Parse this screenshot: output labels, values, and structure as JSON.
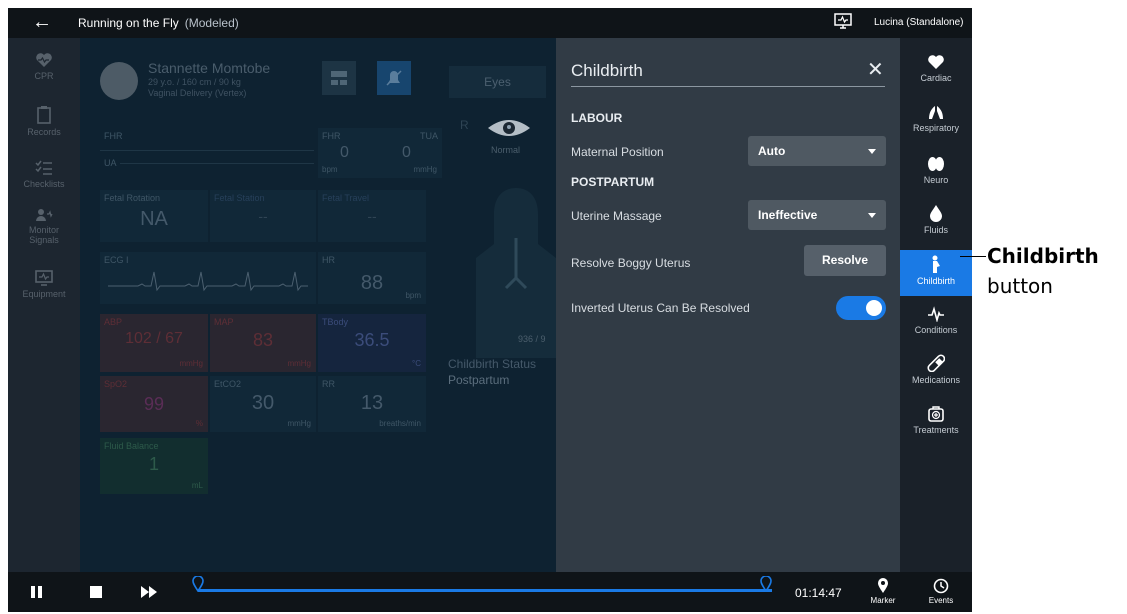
{
  "topbar": {
    "title": "Running on the Fly",
    "mode": "(Modeled)",
    "user": "Lucina (Standalone)"
  },
  "leftnav": [
    {
      "label": "CPR",
      "icon": "heart-pulse-icon"
    },
    {
      "label": "Records",
      "icon": "clipboard-icon"
    },
    {
      "label": "Checklists",
      "icon": "checklist-icon"
    },
    {
      "label": "Monitor Signals",
      "icon": "person-signal-icon"
    },
    {
      "label": "Equipment",
      "icon": "monitor-icon"
    }
  ],
  "patient": {
    "name": "Stannette Momtobe",
    "details": "29 y.o. / 160 cm / 90 kg",
    "delivery": "Vaginal Delivery (Vertex)"
  },
  "eyes": {
    "tab": "Eyes",
    "side": "R",
    "status": "Normal"
  },
  "vitals": {
    "fhr_label": "FHR",
    "ua_label": "UA",
    "fhr": {
      "label": "FHR",
      "value": "0",
      "unit": "bpm"
    },
    "tua": {
      "label": "TUA",
      "value": "0",
      "unit": "mmHg"
    },
    "fetal_rotation": {
      "label": "Fetal Rotation",
      "value": "NA"
    },
    "fetal_station": {
      "label": "Fetal Station",
      "value": "--"
    },
    "fetal_travel": {
      "label": "Fetal Travel",
      "value": "--"
    },
    "ecg": {
      "label": "ECG I"
    },
    "hr": {
      "label": "HR",
      "value": "88",
      "unit": "bpm"
    },
    "abp": {
      "label": "ABP",
      "value": "102 / 67",
      "unit": "mmHg"
    },
    "map": {
      "label": "MAP",
      "value": "83",
      "unit": "mmHg"
    },
    "tbody": {
      "label": "TBody",
      "value": "36.5",
      "unit": "°C"
    },
    "spo2": {
      "label": "SpO2",
      "value": "99",
      "unit": "%"
    },
    "etco2": {
      "label": "EtCO2",
      "value": "30",
      "unit": "mmHg"
    },
    "rr": {
      "label": "RR",
      "value": "13",
      "unit": "breaths/min"
    },
    "fluid": {
      "label": "Fluid Balance",
      "value": "1",
      "unit": "mL"
    }
  },
  "overlay": {
    "count": "936 / 9",
    "status_label": "Childbirth Status",
    "status_value": "Postpartum"
  },
  "panel": {
    "title": "Childbirth",
    "labour_heading": "LABOUR",
    "maternal_position_label": "Maternal Position",
    "maternal_position_value": "Auto",
    "postpartum_heading": "POSTPARTUM",
    "uterine_massage_label": "Uterine Massage",
    "uterine_massage_value": "Ineffective",
    "resolve_label": "Resolve Boggy Uterus",
    "resolve_button": "Resolve",
    "inverted_label": "Inverted Uterus Can Be Resolved"
  },
  "rightnav": [
    {
      "label": "Cardiac",
      "icon": "heart-icon"
    },
    {
      "label": "Respiratory",
      "icon": "lungs-icon"
    },
    {
      "label": "Neuro",
      "icon": "brain-icon"
    },
    {
      "label": "Fluids",
      "icon": "drop-icon"
    },
    {
      "label": "Childbirth",
      "icon": "pregnant-icon"
    },
    {
      "label": "Conditions",
      "icon": "pulse-icon"
    },
    {
      "label": "Medications",
      "icon": "pill-icon"
    },
    {
      "label": "Treatments",
      "icon": "first-aid-icon"
    }
  ],
  "bottombar": {
    "time": "01:14:47",
    "marker_label": "Marker",
    "events_label": "Events"
  },
  "callout": {
    "bold": "Childbirth",
    "rest": "button"
  },
  "colors": {
    "accent": "#1a7ae5",
    "panel": "#313b45",
    "background": "#0e2231"
  }
}
